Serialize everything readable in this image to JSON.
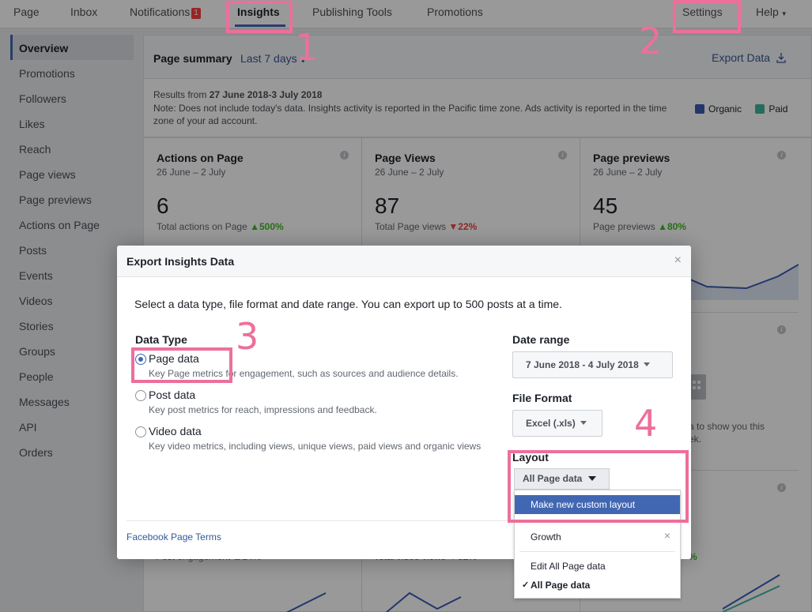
{
  "topnav": {
    "items": [
      {
        "label": "Page"
      },
      {
        "label": "Inbox"
      },
      {
        "label": "Notifications",
        "badge": "1"
      },
      {
        "label": "Insights"
      },
      {
        "label": "Publishing Tools"
      },
      {
        "label": "Promotions"
      },
      {
        "label": "Settings"
      },
      {
        "label": "Help"
      }
    ]
  },
  "sidebar": {
    "items": [
      {
        "label": "Overview"
      },
      {
        "label": "Promotions"
      },
      {
        "label": "Followers"
      },
      {
        "label": "Likes"
      },
      {
        "label": "Reach"
      },
      {
        "label": "Page views"
      },
      {
        "label": "Page previews"
      },
      {
        "label": "Actions on Page"
      },
      {
        "label": "Posts"
      },
      {
        "label": "Events"
      },
      {
        "label": "Videos"
      },
      {
        "label": "Stories"
      },
      {
        "label": "Groups"
      },
      {
        "label": "People"
      },
      {
        "label": "Messages"
      },
      {
        "label": "API"
      },
      {
        "label": "Orders"
      }
    ]
  },
  "summary": {
    "title": "Page summary",
    "range": "Last 7 days",
    "export_label": "Export Data",
    "results_prefix": "Results from ",
    "results_dates": "27 June 2018-3 July 2018",
    "note": "Note: Does not include today's data. Insights activity is reported in the Pacific time zone. Ads activity is reported in the time zone of your ad account.",
    "legend": [
      {
        "label": "Organic",
        "color": "#3b5bb5"
      },
      {
        "label": "Paid",
        "color": "#3fb59b"
      }
    ]
  },
  "cards": [
    {
      "title": "Actions on Page",
      "sub": "26 June – 2 July",
      "value": "6",
      "foot": "Total actions on Page",
      "delta": "500%",
      "dir": "up"
    },
    {
      "title": "Page Views",
      "sub": "26 June – 2 July",
      "value": "87",
      "foot": "Total Page views",
      "delta": "22%",
      "dir": "down"
    },
    {
      "title": "Page previews",
      "sub": "26 June – 2 July",
      "value": "45",
      "foot": "Page previews",
      "delta": "80%",
      "dir": "up"
    }
  ],
  "background_snippets": {
    "right_text": "a to show you this\nek.",
    "post_engagement": "Post engagement",
    "post_engagement_delta": "24%",
    "total_video_views": "Total video views",
    "total_video_views_delta": "32%",
    "right_delta": "%"
  },
  "modal": {
    "title": "Export Insights Data",
    "close": "×",
    "intro": "Select a data type, file format and date range. You can export up to 500 posts at a time.",
    "data_type_label": "Data Type",
    "options": [
      {
        "label": "Page data",
        "desc": "Key Page metrics for engagement, such as sources and audience details.",
        "checked": true
      },
      {
        "label": "Post data",
        "desc": "Key post metrics for reach, impressions and feedback.",
        "checked": false
      },
      {
        "label": "Video data",
        "desc": "Key video metrics, including views, unique views, paid views and organic views",
        "checked": false
      }
    ],
    "date_range_label": "Date range",
    "date_range_value": "7 June 2018 - 4 July 2018",
    "file_format_label": "File Format",
    "file_format_value": "Excel (.xls)",
    "layout_label": "Layout",
    "layout_value": "All Page data",
    "terms_link": "Facebook Page Terms"
  },
  "layout_dropdown": {
    "make_new": "Make new custom layout",
    "custom": "Growth",
    "remove": "×",
    "edit": "Edit All Page data",
    "selected": "All Page data",
    "check": "✓"
  },
  "annotations": [
    "1",
    "2",
    "3",
    "4"
  ]
}
